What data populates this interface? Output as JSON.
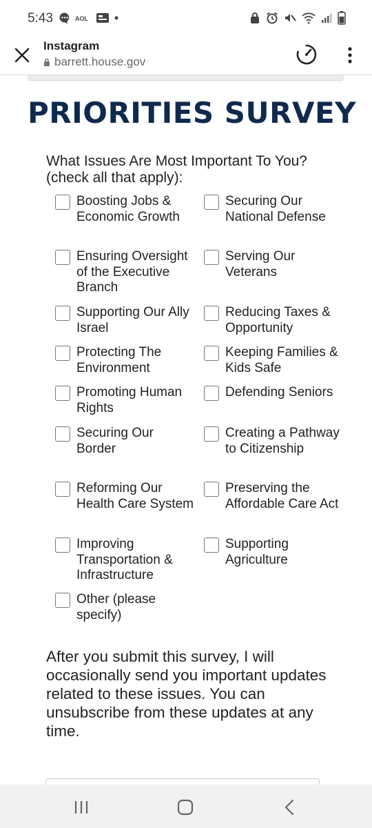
{
  "status_bar": {
    "time": "5:43",
    "left_icons": [
      "chat-bubble-icon",
      "aol-icon",
      "caller-id-icon",
      "dot-icon"
    ],
    "right_icons": [
      "lock-icon",
      "alarm-icon",
      "mute-icon",
      "wifi-icon",
      "signal-icon",
      "battery-icon"
    ]
  },
  "browser": {
    "title": "Instagram",
    "url": "barrett.house.gov"
  },
  "survey": {
    "title": "PRIORITIES SURVEY",
    "question": "What Issues Are Most Important To You? (check all that apply):",
    "options": [
      {
        "label": "Boosting Jobs & Economic Growth",
        "checked": false
      },
      {
        "label": "Securing Our National Defense",
        "checked": false
      },
      {
        "label": "Ensuring Oversight of the Executive Branch",
        "checked": false
      },
      {
        "label": "Serving Our Veterans",
        "checked": false
      },
      {
        "label": "Supporting Our Ally Israel",
        "checked": false
      },
      {
        "label": "Reducing Taxes & Opportunity",
        "checked": false
      },
      {
        "label": "Protecting The Environment",
        "checked": false
      },
      {
        "label": "Keeping Families & Kids Safe",
        "checked": false
      },
      {
        "label": "Promoting Human Rights",
        "checked": false
      },
      {
        "label": "Defending Seniors",
        "checked": false
      },
      {
        "label": "Securing Our Border",
        "checked": false
      },
      {
        "label": "Creating a Pathway to Citizenship",
        "checked": false
      },
      {
        "label": "Reforming Our Health Care System",
        "checked": false
      },
      {
        "label": "Preserving the Affordable Care Act",
        "checked": false
      },
      {
        "label": "Improving Transportation & Infrastructure",
        "checked": false
      },
      {
        "label": "Supporting Agriculture",
        "checked": false
      },
      {
        "label": "Other (please specify)",
        "checked": false
      }
    ],
    "note": "After you submit this survey, I will occasionally send you important updates related to these issues. You can unsubscribe from these updates at any time."
  },
  "colors": {
    "title": "#0f2a4f",
    "text": "#222222",
    "nav_bar": "#f1f1f1"
  }
}
